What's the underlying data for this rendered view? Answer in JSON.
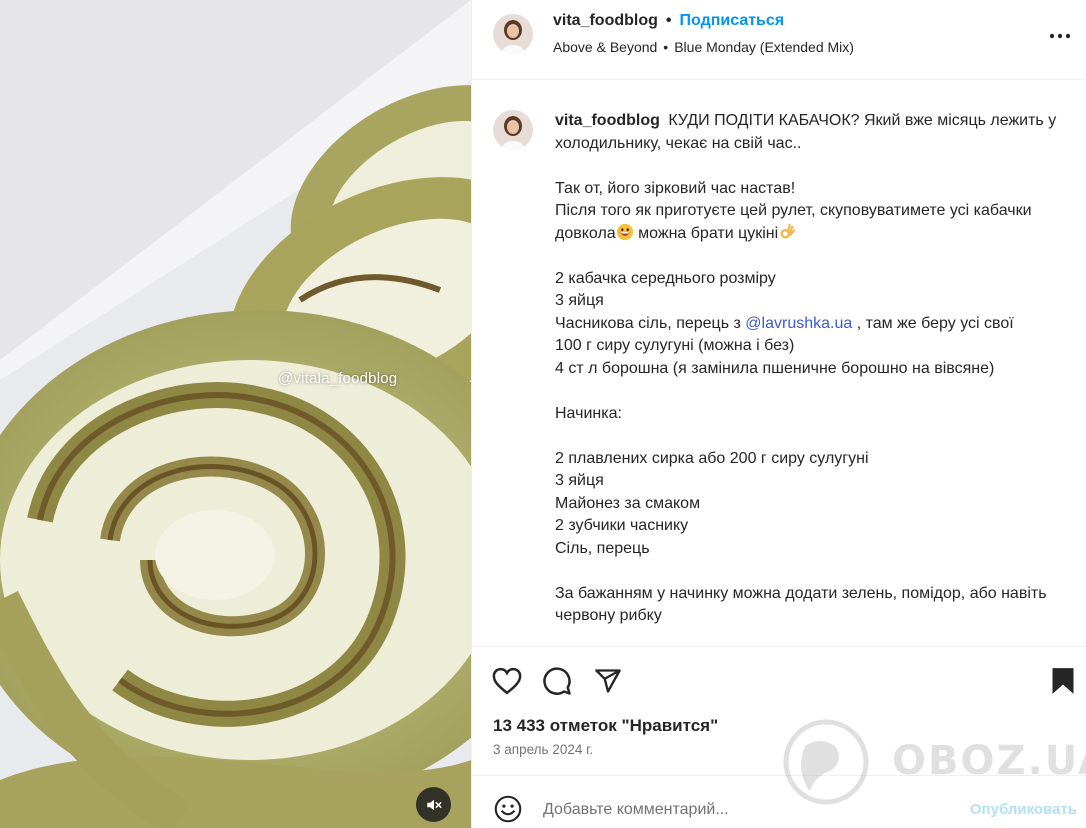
{
  "post": {
    "username": "vita_foodblog",
    "separator": "•",
    "follow_label": "Подписаться",
    "audio_artist": "Above & Beyond",
    "audio_sep": "•",
    "audio_track": "Blue Monday (Extended Mix)",
    "media_watermark": "@vitala_foodblog"
  },
  "caption": {
    "username": "vita_foodblog",
    "lines": [
      "КУДИ ПОДІТИ КАБАЧОК? Який вже місяць лежить у холодильнику, чекає на свій час..",
      "",
      "Так от, його зірковий час настав!",
      "Після того як приготуєте цей рулет, скуповуватимете усі кабачки довкола",
      "можна брати цукіні",
      "",
      "2 кабачка середнього розміру",
      "3 яйця",
      "Часникова сіль, перець з",
      "@lavrushka.ua",
      ", там же беру усі свої",
      "100 г сиру сулугуні (можна і без)",
      "4 ст л борошна (я замінила пшеничне борошно на вівсяне)",
      "",
      "Начинка:",
      "",
      "2 плавлених сирка або 200 г сиру сулугуні",
      "3 яйця",
      "Майонез за смаком",
      "2 зубчики часнику",
      "Сіль, перець",
      "",
      "За бажанням у начинку можна додати зелень, помідор, або навіть червону рибку"
    ]
  },
  "stats": {
    "likes": "13 433 отметок \"Нравится\"",
    "date": "3 апрель 2024 г."
  },
  "comment": {
    "placeholder": "Добавьте комментарий...",
    "publish_label": "Опубликовать"
  },
  "site_watermark": "OBOZ.UA",
  "colors": {
    "accent_blue": "#0095f6",
    "publish_disabled": "#b2dffc",
    "text": "#262626",
    "muted": "#737373"
  },
  "icons": [
    "more-icon",
    "heart-icon",
    "comment-icon",
    "share-icon",
    "bookmark-icon",
    "emoji-icon",
    "mute-icon",
    "grinning-emoji-icon",
    "ok-hand-emoji-icon"
  ]
}
